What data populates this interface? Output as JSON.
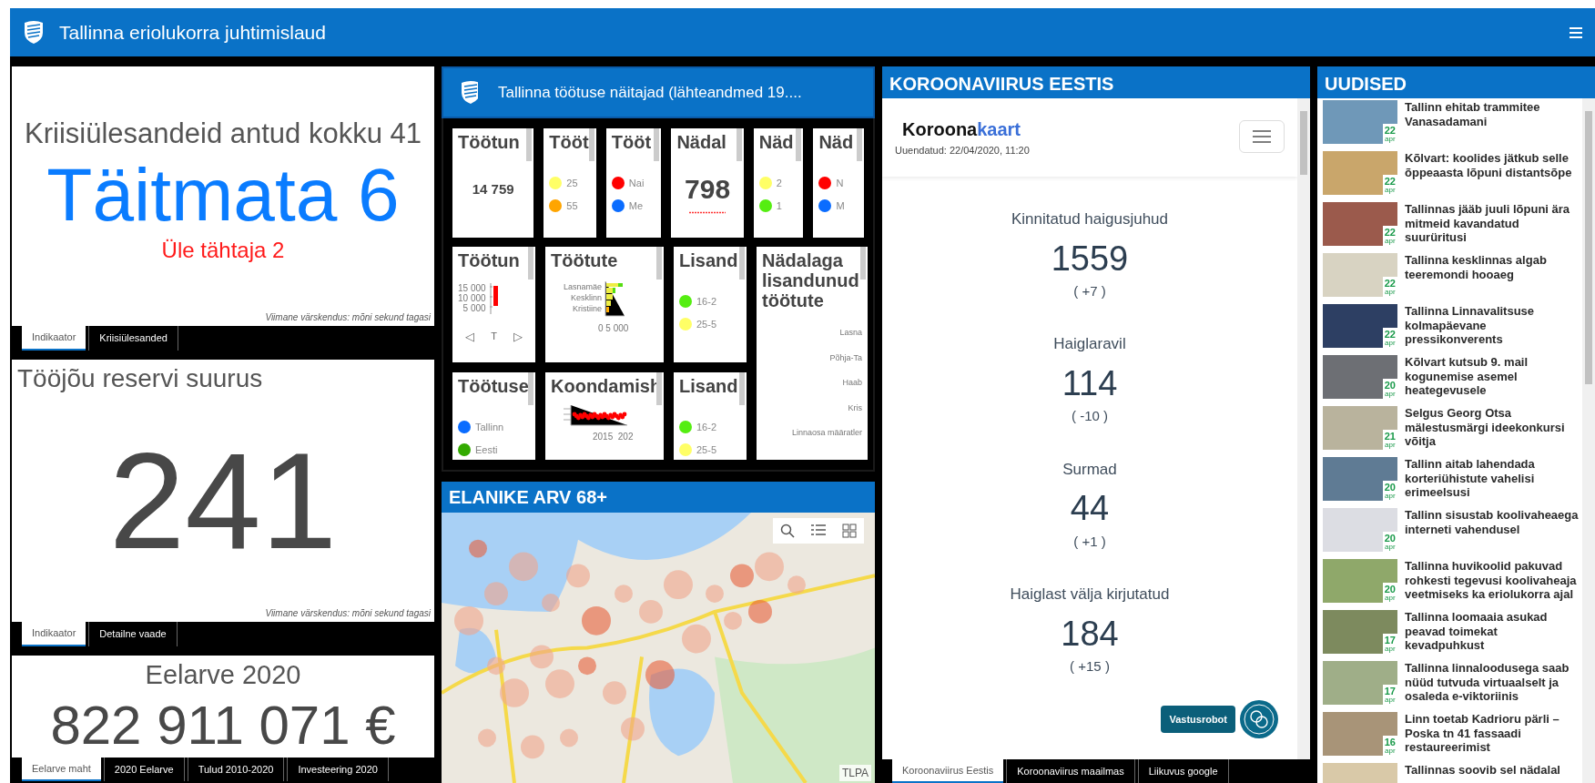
{
  "header": {
    "title": "Tallinna eriolukorra juhtimislaud"
  },
  "crisis_card": {
    "total": "Kriisiülesandeid antud kokku 41",
    "open": "Täitmata 6",
    "overdue": "Üle tähtaja 2",
    "updated": "Viimane värskendus: mõni sekund tagasi",
    "tabs": [
      {
        "label": "Indikaator",
        "selected": true
      },
      {
        "label": "Kriisiülesanded",
        "selected": false
      }
    ]
  },
  "workforce_card": {
    "title": "Tööjõu reservi suurus",
    "value": "241",
    "updated": "Viimane värskendus: mõni sekund tagasi",
    "tabs": [
      {
        "label": "Indikaator",
        "selected": true
      },
      {
        "label": "Detailne vaade",
        "selected": false
      }
    ]
  },
  "budget_card": {
    "title": "Eelarve 2020",
    "value": "822 911 071 €",
    "tabs": [
      {
        "label": "Eelarve maht",
        "selected": true
      },
      {
        "label": "2020 Eelarve",
        "selected": false
      },
      {
        "label": "Tulud 2010-2020",
        "selected": false
      },
      {
        "label": "Investeering 2020",
        "selected": false
      }
    ]
  },
  "unemployment_panel": {
    "title": "Tallinna töötuse näitajad (lähteandmed 19....",
    "top_row": [
      {
        "kind": "number",
        "title": "Töötun",
        "value": "14 759"
      },
      {
        "kind": "legend",
        "title": "Tööt",
        "items": [
          {
            "label": "25",
            "color": "#ffff66"
          },
          {
            "label": "55",
            "color": "#ffa500"
          }
        ]
      },
      {
        "kind": "legend",
        "title": "Tööt",
        "items": [
          {
            "label": "Nai",
            "color": "#ff0000"
          },
          {
            "label": "Me",
            "color": "#0a6cff"
          }
        ]
      },
      {
        "kind": "number",
        "title": "Nädal",
        "value": "798"
      },
      {
        "kind": "legend",
        "title": "Näd",
        "items": [
          {
            "label": "2",
            "color": "#ffff66"
          },
          {
            "label": "1",
            "color": "#55ee11"
          }
        ]
      },
      {
        "kind": "legend",
        "title": "Näd",
        "items": [
          {
            "label": "N",
            "color": "#ff0000"
          },
          {
            "label": "M",
            "color": "#0a6cff"
          }
        ]
      }
    ],
    "lower_grid": [
      {
        "kind": "columns",
        "title": "Töötun",
        "axis_labels": [
          "15 000",
          "10 000",
          "5 000"
        ],
        "pager": {
          "prev": "◁",
          "label": "T",
          "next": "▷"
        }
      },
      {
        "kind": "bars",
        "title": "Töötute",
        "axis_labels": [
          "Lasnamäe",
          "Kesklinn",
          "Kristiine"
        ],
        "x_label": "0 5 000"
      },
      {
        "kind": "legend",
        "title": "Lisand",
        "items": [
          {
            "label": "16-2",
            "color": "#55ee11"
          },
          {
            "label": "25-5",
            "color": "#ffff66"
          }
        ]
      },
      {
        "kind": "list",
        "title": "Nädalaga lisandunud töötute",
        "items": [
          "Lasna",
          "Põhja-Ta",
          "Haab",
          "Kris",
          "Linnaosa määratler"
        ]
      },
      {
        "kind": "legend",
        "title": "Töötuse",
        "items": [
          {
            "label": "Tallinn",
            "color": "#0a6cff"
          },
          {
            "label": "Eesti",
            "color": "#33aa00"
          }
        ]
      },
      {
        "kind": "scatter",
        "title": "Koondamish",
        "x_label": "2015  202"
      },
      {
        "kind": "legend",
        "title": "Lisand",
        "items": [
          {
            "label": "16-2",
            "color": "#55ee11"
          },
          {
            "label": "25-5",
            "color": "#ffff66"
          }
        ]
      }
    ]
  },
  "map_panel": {
    "title": "ELANIKE ARV 68+",
    "attribution": "TLPA"
  },
  "corona_panel": {
    "title": "KOROONAVIIRUS EESTIS",
    "brand_main": "Koroona",
    "brand_accent": "kaart",
    "updated": "Uuendatud: 22/04/2020, 11:20",
    "stats": [
      {
        "label": "Kinnitatud haigusjuhud",
        "value": "1559",
        "change": "( +7 )"
      },
      {
        "label": "Haiglaravil",
        "value": "114",
        "change": "( -10 )"
      },
      {
        "label": "Surmad",
        "value": "44",
        "change": "( +1 )"
      },
      {
        "label": "Haiglast välja kirjutatud",
        "value": "184",
        "change": "( +15 )"
      }
    ],
    "chat_label": "Vastusrobot",
    "tabs": [
      {
        "label": "Koroonaviirus Eestis",
        "selected": true
      },
      {
        "label": "Koroonaviirus maailmas",
        "selected": false
      },
      {
        "label": "Liikuvus google",
        "selected": false
      }
    ]
  },
  "news_panel": {
    "title": "UUDISED",
    "items": [
      {
        "day": "22",
        "month": "apr",
        "headline": "Tallinn ehitab trammitee Vanasadamani"
      },
      {
        "day": "22",
        "month": "apr",
        "headline": "Kõlvart: koolides jätkub selle õppeaasta lõpuni distantsõpe"
      },
      {
        "day": "22",
        "month": "apr",
        "headline": "Tallinnas jääb juuli lõpuni ära mitmeid kavandatud suurüritusi"
      },
      {
        "day": "22",
        "month": "apr",
        "headline": "Tallinna kesklinnas algab teeremondi hooaeg"
      },
      {
        "day": "22",
        "month": "apr",
        "headline": "Tallinna Linnavalitsuse kolmapäevane pressikonverents"
      },
      {
        "day": "20",
        "month": "apr",
        "headline": "Kõlvart kutsub 9. mail kogunemise asemel heategevusele"
      },
      {
        "day": "21",
        "month": "apr",
        "headline": "Selgus Georg Otsa mälestusmärgi ideekonkursi võitja"
      },
      {
        "day": "20",
        "month": "apr",
        "headline": "Tallinn aitab lahendada korteriühistute vahelisi erimeelsusi"
      },
      {
        "day": "20",
        "month": "apr",
        "headline": "Tallinn sisustab koolivaheaega interneti vahendusel"
      },
      {
        "day": "20",
        "month": "apr",
        "headline": "Tallinna huvikoolid pakuvad rohkesti tegevusi koolivaheaja veetmiseks ka eriolukorra ajal"
      },
      {
        "day": "17",
        "month": "apr",
        "headline": "Tallinna loomaaia asukad peavad toimekat kevadpuhkust"
      },
      {
        "day": "17",
        "month": "apr",
        "headline": "Tallinna linnaloodusega saab nüüd tutvuda virtuaalselt ja osaleda e-viktoriinis"
      },
      {
        "day": "16",
        "month": "apr",
        "headline": "Linn toetab Kadrioru pärli – Poska tn 41 fassaadi restaureerimist"
      },
      {
        "headline": "Tallinnas soovib sel nädalal"
      }
    ]
  }
}
